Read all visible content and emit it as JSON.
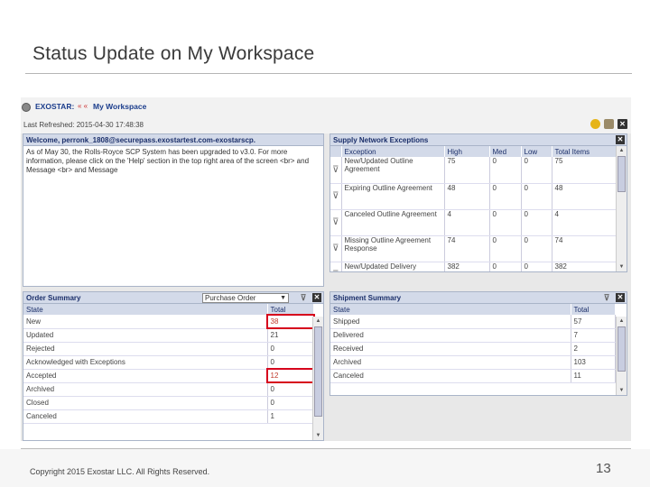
{
  "slide": {
    "title": "Status Update on My Workspace",
    "copyright": "Copyright 2015 Exostar LLC. All Rights Reserved.",
    "page_number": "13"
  },
  "app": {
    "brand": "EXOSTAR:",
    "crumb_sep": "« «",
    "crumb": "My Workspace",
    "last_refreshed": "Last Refreshed: 2015-04-30 17:48:38"
  },
  "welcome": {
    "title": "Welcome, perronk_1808@securepass.exostartest.com-exostarscp.",
    "message": "As of May 30, the Rolls-Royce SCP System has been upgraded to v3.0. For more information, please click on the 'Help' section in the top right area of the screen <br> and Message <br> and Message"
  },
  "supply_network": {
    "title": "Supply Network Exceptions",
    "columns": [
      "Exception",
      "High",
      "Med",
      "Low",
      "Total Items"
    ],
    "rows": [
      [
        "New/Updated Outline Agreement",
        "75",
        "0",
        "0",
        "75"
      ],
      [
        "Expiring Outline Agreement",
        "48",
        "0",
        "0",
        "48"
      ],
      [
        "Canceled Outline Agreement",
        "4",
        "0",
        "0",
        "4"
      ],
      [
        "Missing Outline Agreement Response",
        "74",
        "0",
        "0",
        "74"
      ],
      [
        "New/Updated Delivery",
        "382",
        "0",
        "0",
        "382"
      ]
    ]
  },
  "order_summary": {
    "title": "Order Summary",
    "select_value": "Purchase Order",
    "columns": [
      "State",
      "Total"
    ],
    "rows": [
      [
        "New",
        "38"
      ],
      [
        "Updated",
        "21"
      ],
      [
        "Rejected",
        "0"
      ],
      [
        "Acknowledged with Exceptions",
        "0"
      ],
      [
        "Accepted",
        "12"
      ],
      [
        "Archived",
        "0"
      ],
      [
        "Closed",
        "0"
      ],
      [
        "Canceled",
        "1"
      ]
    ]
  },
  "shipment_summary": {
    "title": "Shipment Summary",
    "columns": [
      "State",
      "Total"
    ],
    "rows": [
      [
        "Shipped",
        "57"
      ],
      [
        "Delivered",
        "7"
      ],
      [
        "Received",
        "2"
      ],
      [
        "Archived",
        "103"
      ],
      [
        "Canceled",
        "11"
      ]
    ]
  },
  "colors": {
    "panel_header": "#d3dae9",
    "highlight": "#d6001c",
    "brand_blue": "#1b3d8c"
  }
}
